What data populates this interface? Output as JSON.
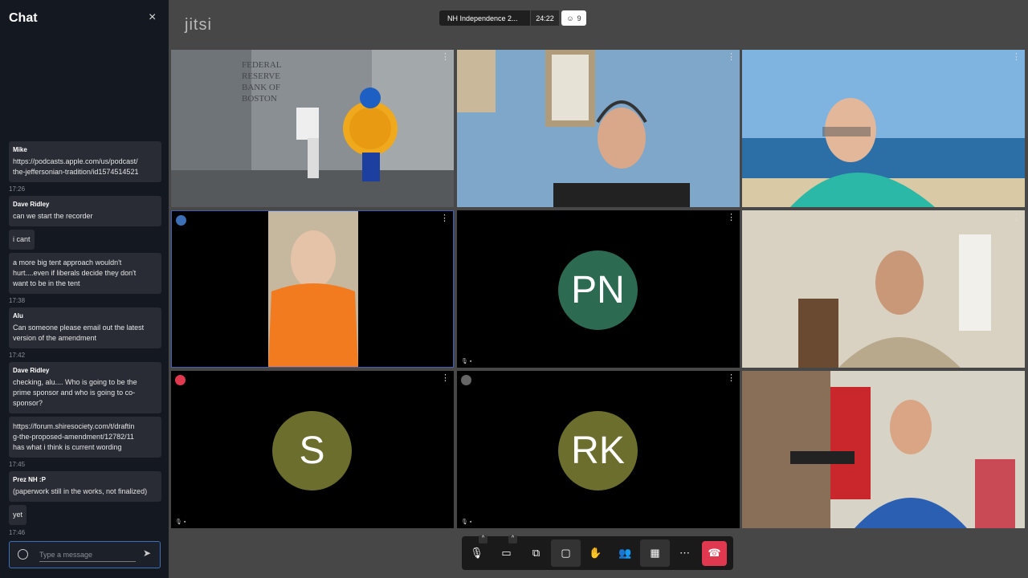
{
  "chat": {
    "title": "Chat",
    "close": "×",
    "messages": [
      {
        "sender": "Mike",
        "lines": [
          "https://podcasts.apple.com/us/podcast/",
          "the-jeffersonian-tradition/id1574514521"
        ],
        "time": "17:26"
      },
      {
        "sender": "Dave Ridley",
        "lines": [
          "can we start the recorder"
        ],
        "time": ""
      },
      {
        "sender": "",
        "lines": [
          "i cant"
        ],
        "time": ""
      },
      {
        "sender": "",
        "lines": [
          "a more big tent approach wouldn't",
          "hurt....even if liberals decide they don't",
          "want to be in the tent"
        ],
        "time": "17:38"
      },
      {
        "sender": "Alu",
        "lines": [
          "Can someone please email out the latest",
          "version of the amendment"
        ],
        "time": "17:42"
      },
      {
        "sender": "Dave Ridley",
        "lines": [
          "checking, alu....  Who is going to be the",
          "prime sponsor and who is going to co-",
          "sponsor?"
        ],
        "time": ""
      },
      {
        "sender": "",
        "lines": [
          "https://forum.shiresociety.com/t/draftin",
          "g-the-proposed-amendment/12782/11",
          "  has what i think is current wording"
        ],
        "time": "17:45"
      },
      {
        "sender": "Prez NH :P",
        "lines": [
          "(paperwork still in the works, not finalized)"
        ],
        "time": ""
      },
      {
        "sender": "",
        "lines": [
          "yet"
        ],
        "time": "17:46"
      }
    ],
    "input_placeholder": "Type a message",
    "emoji_icon": "smiley-icon",
    "send_icon": "send-icon"
  },
  "header": {
    "logo": "jitsi",
    "meeting_name": "NH Independence 2...",
    "timer": "24:22",
    "participant_count": "9"
  },
  "tiles": [
    {
      "kind": "video",
      "scene": "federal-reserve",
      "sign": "FEDERAL\nRESERVE\nBANK OF\nBOSTON"
    },
    {
      "kind": "video",
      "scene": "headset-man"
    },
    {
      "kind": "video",
      "scene": "beach-man"
    },
    {
      "kind": "video",
      "scene": "orange-shirt"
    },
    {
      "kind": "avatar",
      "initials": "PN",
      "color": "#2d6a52"
    },
    {
      "kind": "video",
      "scene": "living-room"
    },
    {
      "kind": "avatar",
      "initials": "S",
      "color": "#6b6e2c"
    },
    {
      "kind": "avatar",
      "initials": "RK",
      "color": "#6b6e2c"
    },
    {
      "kind": "video",
      "scene": "studio"
    }
  ],
  "toolbar": [
    "microphone-icon",
    "camera-icon",
    "screenshare-icon",
    "chat-icon",
    "raise-hand-icon",
    "participants-icon",
    "tile-view-icon",
    "more-icon",
    "hangup-icon"
  ]
}
